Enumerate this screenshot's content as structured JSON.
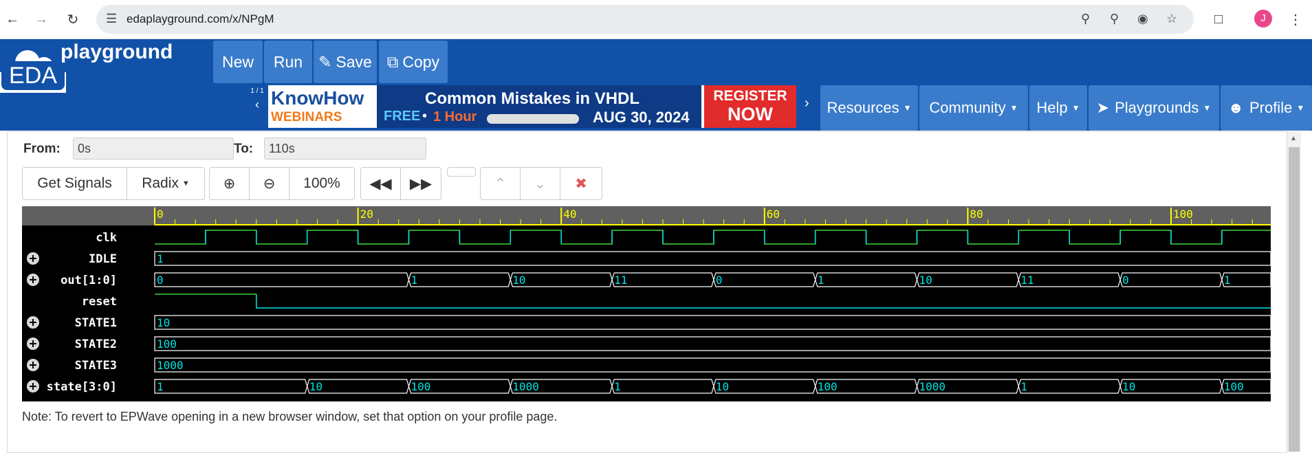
{
  "browser": {
    "url": "edaplayground.com/x/NPgM",
    "avatar_letter": "J"
  },
  "header": {
    "logo_main": "EDA",
    "logo_sub": "playground",
    "buttons": [
      "New",
      "Run",
      "Save",
      "Copy"
    ],
    "ad": {
      "pager": "1 / 1",
      "brand_1": "KnowHow",
      "brand_2": "WEBINARS",
      "title": "Common Mistakes in VHDL",
      "free": "FREE",
      "duration": "1 Hour",
      "date": "AUG 30, 2024",
      "cta_1": "REGISTER",
      "cta_2": "NOW"
    },
    "menus": [
      "Resources",
      "Community",
      "Help",
      "Playgrounds",
      "Profile"
    ]
  },
  "toolbar": {
    "from_label": "From:",
    "from_value": "0s",
    "to_label": "To:",
    "to_value": "110s",
    "get_signals": "Get Signals",
    "radix": "Radix",
    "zoom": "100%"
  },
  "waveform": {
    "time_ticks": [
      "0",
      "20",
      "40",
      "60",
      "80",
      "100"
    ],
    "signals": [
      {
        "name": "clk",
        "type": "clock",
        "expand": false
      },
      {
        "name": "IDLE",
        "type": "bus",
        "expand": true,
        "segments": [
          {
            "t": 0,
            "v": "1"
          }
        ]
      },
      {
        "name": "out[1:0]",
        "type": "bus",
        "expand": true,
        "segments": [
          {
            "t": 0,
            "v": "0"
          },
          {
            "t": 25,
            "v": "1"
          },
          {
            "t": 35,
            "v": "10"
          },
          {
            "t": 45,
            "v": "11"
          },
          {
            "t": 55,
            "v": "0"
          },
          {
            "t": 65,
            "v": "1"
          },
          {
            "t": 75,
            "v": "10"
          },
          {
            "t": 85,
            "v": "11"
          },
          {
            "t": 95,
            "v": "0"
          },
          {
            "t": 105,
            "v": "1"
          }
        ]
      },
      {
        "name": "reset",
        "type": "bit",
        "expand": false,
        "high_until": 10
      },
      {
        "name": "STATE1",
        "type": "bus",
        "expand": true,
        "segments": [
          {
            "t": 0,
            "v": "10"
          }
        ]
      },
      {
        "name": "STATE2",
        "type": "bus",
        "expand": true,
        "segments": [
          {
            "t": 0,
            "v": "100"
          }
        ]
      },
      {
        "name": "STATE3",
        "type": "bus",
        "expand": true,
        "segments": [
          {
            "t": 0,
            "v": "1000"
          }
        ]
      },
      {
        "name": "state[3:0]",
        "type": "bus",
        "expand": true,
        "segments": [
          {
            "t": 0,
            "v": "1"
          },
          {
            "t": 15,
            "v": "10"
          },
          {
            "t": 25,
            "v": "100"
          },
          {
            "t": 35,
            "v": "1000"
          },
          {
            "t": 45,
            "v": "1"
          },
          {
            "t": 55,
            "v": "10"
          },
          {
            "t": 65,
            "v": "100"
          },
          {
            "t": 75,
            "v": "1000"
          },
          {
            "t": 85,
            "v": "1"
          },
          {
            "t": 95,
            "v": "10"
          },
          {
            "t": 105,
            "v": "100"
          }
        ]
      }
    ]
  },
  "note": "Note: To revert to EPWave opening in a new browser window, set that option on your profile page.",
  "colors": {
    "header_blue": "#1152a8",
    "button_blue": "#3a7ccb",
    "wave_green": "#3cd63c",
    "wave_cyan": "#00e5e5",
    "axis_yellow": "#ffff00"
  }
}
